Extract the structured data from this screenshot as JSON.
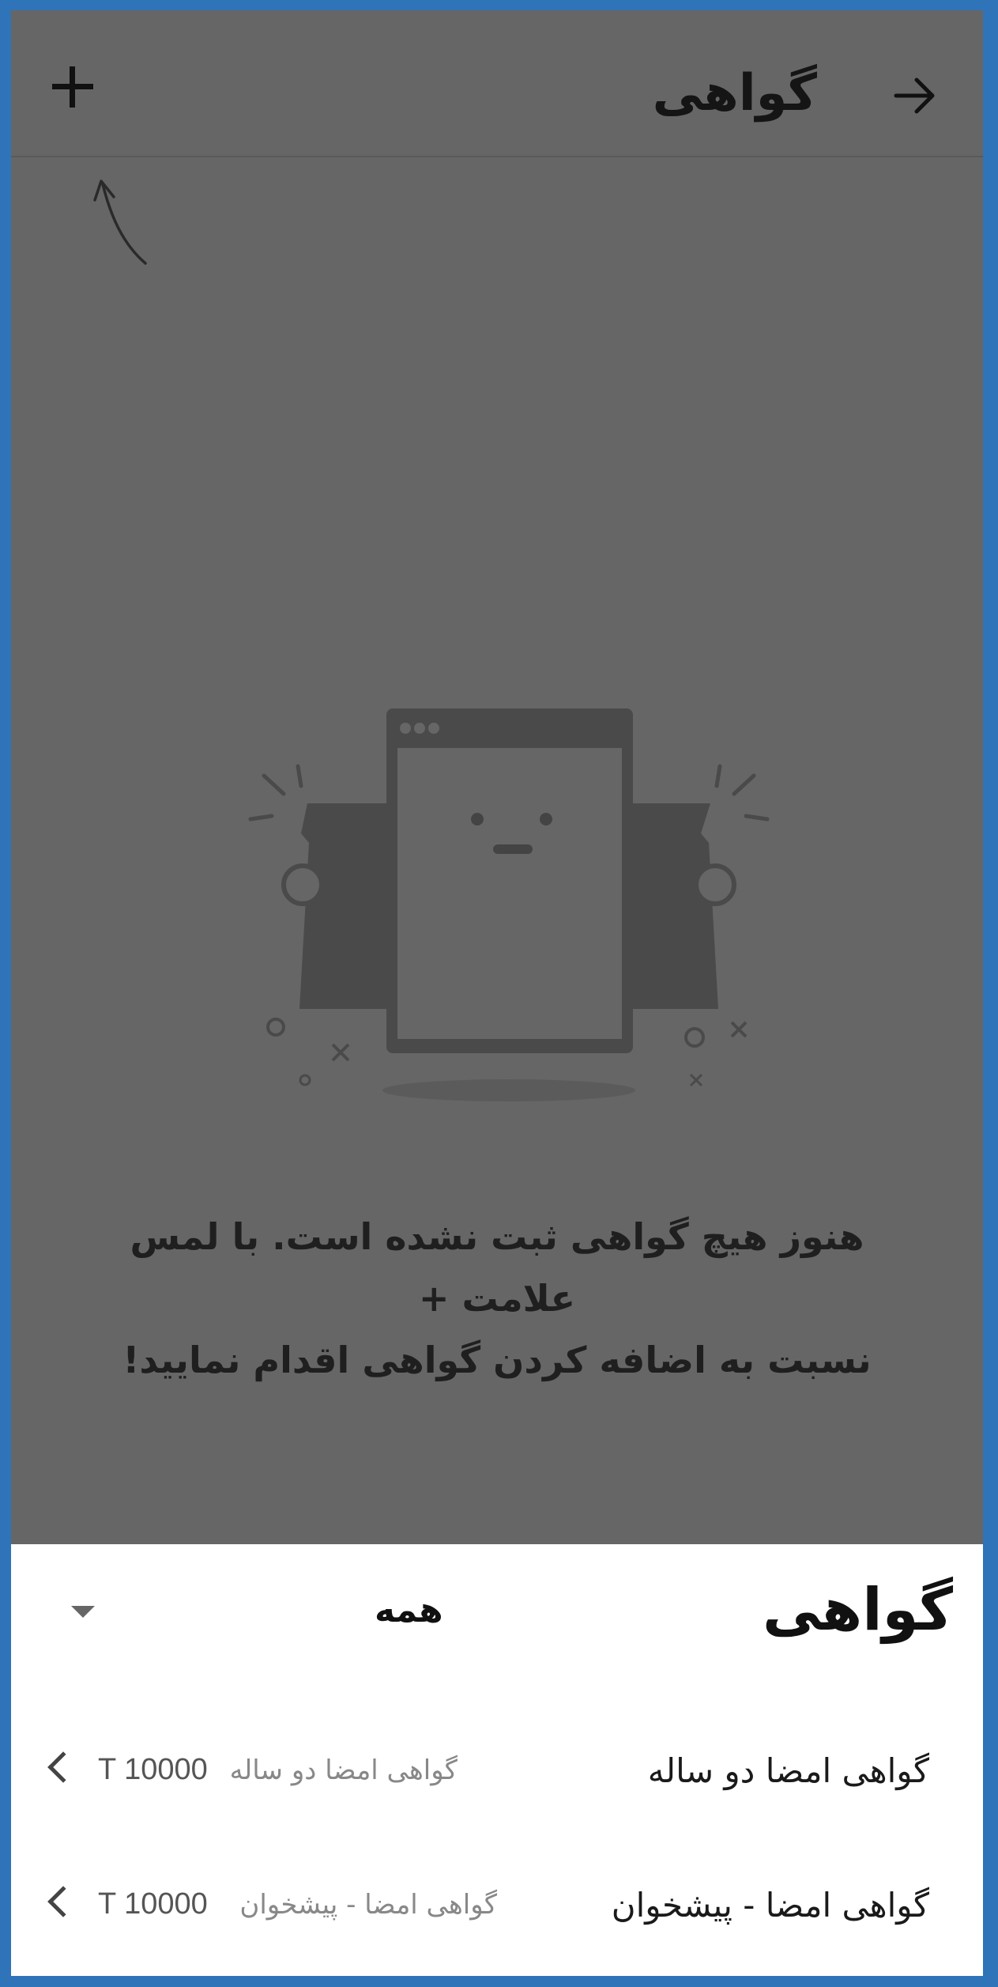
{
  "header": {
    "title": "گواهی",
    "add_icon": "plus-icon",
    "back_icon": "arrow-right-icon"
  },
  "empty_state": {
    "message_line1": "هنوز هیچ گواهی ثبت نشده است. با لمس علامت +",
    "message_line2": "نسبت به اضافه کردن گواهی اقدام نمایید!"
  },
  "sheet": {
    "title": "گواهی",
    "filter": {
      "selected": "همه",
      "icon": "caret-down-icon"
    },
    "items": [
      {
        "name": "گواهی امضا دو ساله",
        "subtitle": "گواهی امضا دو ساله",
        "price": "T 10000",
        "icon": "chevron-left-icon"
      },
      {
        "name": "گواهی امضا - پیشخوان",
        "subtitle": "گواهی امضا - پیشخوان",
        "price": "T 10000",
        "icon": "chevron-left-icon"
      }
    ]
  },
  "colors": {
    "frame_border": "#2f73b8",
    "overlay": "#666666",
    "sheet_bg": "#ffffff"
  }
}
